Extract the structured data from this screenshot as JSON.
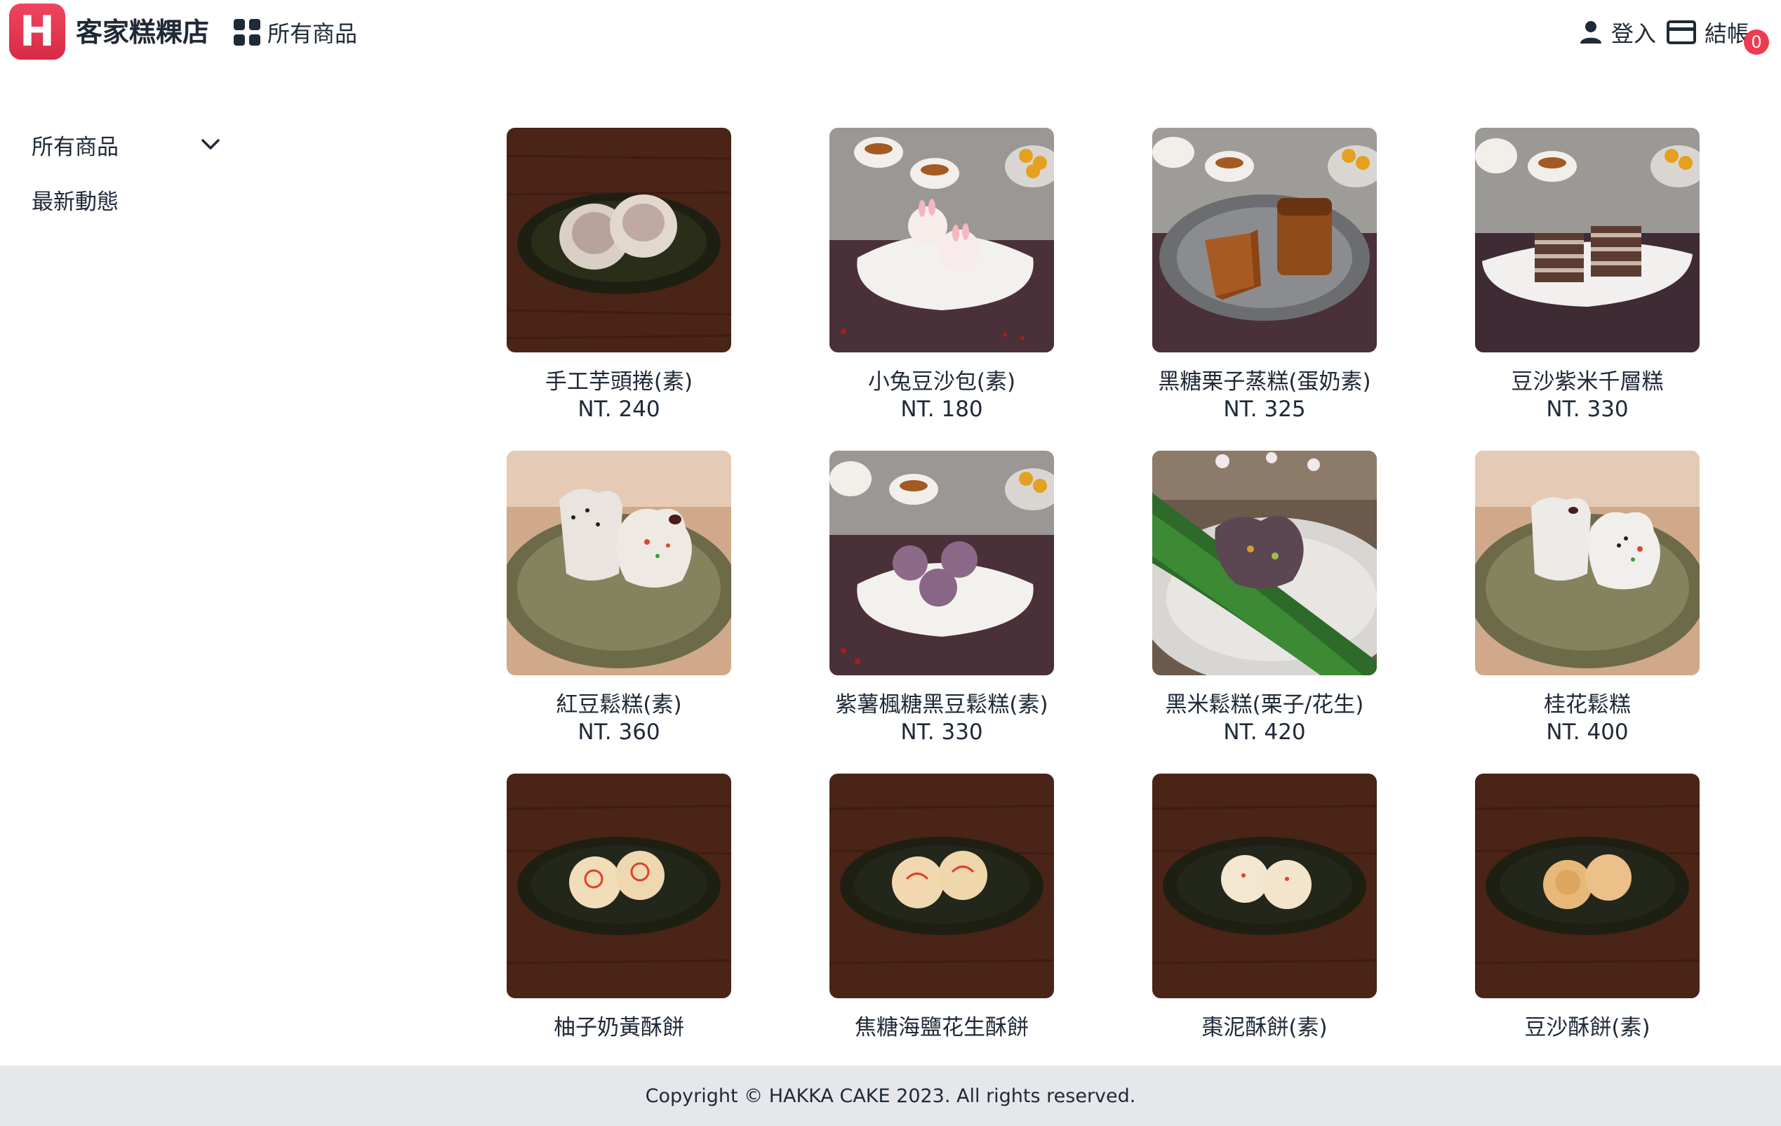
{
  "header": {
    "logo_letter": "H",
    "brand": "客家糕粿店",
    "nav_all": "所有商品",
    "login": "登入",
    "checkout": "結帳",
    "cart_count": "0"
  },
  "sidebar": {
    "items": [
      {
        "label": "所有商品",
        "icon": "chevron-down-icon"
      },
      {
        "label": "最新動態"
      }
    ]
  },
  "products": [
    {
      "name": "手工芋頭捲(素)",
      "price": "NT. 240"
    },
    {
      "name": "小兔豆沙包(素)",
      "price": "NT. 180"
    },
    {
      "name": "黑糖栗子蒸糕(蛋奶素)",
      "price": "NT. 325"
    },
    {
      "name": "豆沙紫米千層糕",
      "price": "NT. 330"
    },
    {
      "name": "紅豆鬆糕(素)",
      "price": "NT. 360"
    },
    {
      "name": "紫薯楓糖黑豆鬆糕(素)",
      "price": "NT. 330"
    },
    {
      "name": "黑米鬆糕(栗子/花生)",
      "price": "NT. 420"
    },
    {
      "name": "桂花鬆糕",
      "price": "NT. 400"
    },
    {
      "name": "柚子奶黃酥餅",
      "price": ""
    },
    {
      "name": "焦糖海鹽花生酥餅",
      "price": ""
    },
    {
      "name": "棗泥酥餅(素)",
      "price": ""
    },
    {
      "name": "豆沙酥餅(素)",
      "price": ""
    }
  ],
  "footer": {
    "copyright": "Copyright © HAKKA CAKE 2023. All rights reserved."
  },
  "colors": {
    "brand_red": "#e33551",
    "badge_red": "#ef3b50",
    "text": "#1f2937",
    "footer_bg": "#e5e7eb"
  }
}
